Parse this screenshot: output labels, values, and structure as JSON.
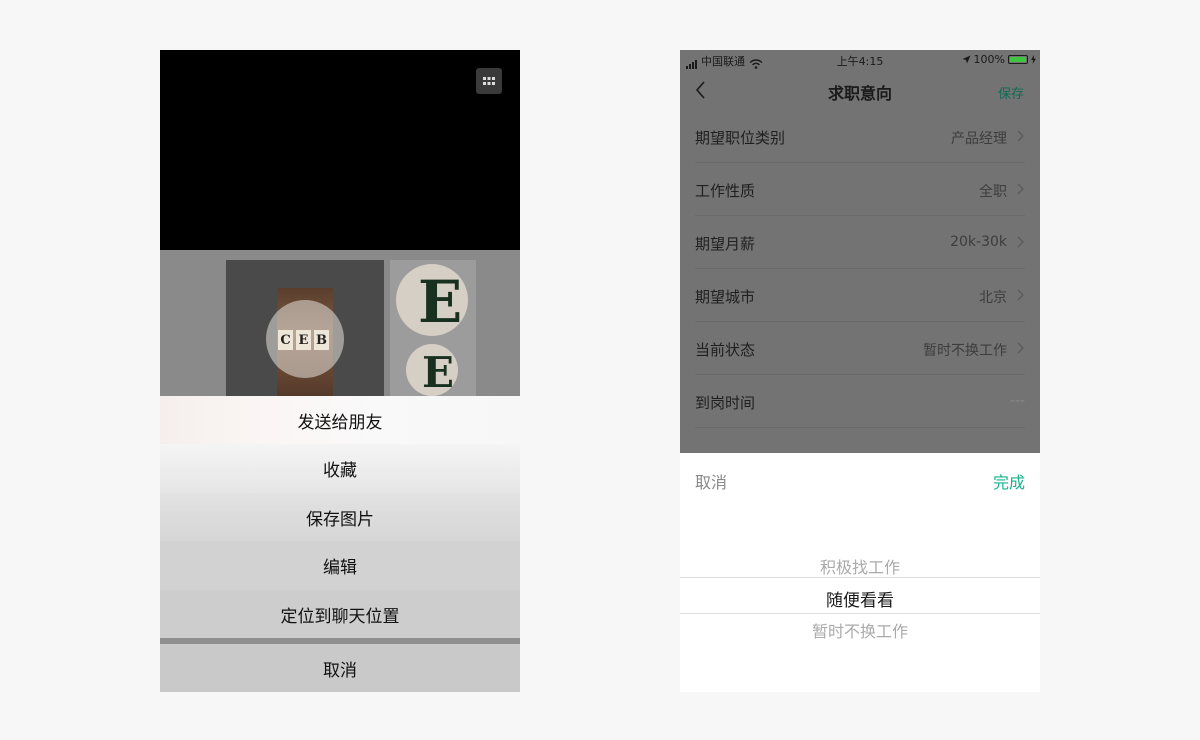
{
  "left_screen": {
    "photo_tiles": [
      "C",
      "E",
      "B"
    ],
    "side_letter": "E",
    "action_sheet": {
      "items": [
        "发送给朋友",
        "收藏",
        "保存图片",
        "编辑",
        "定位到聊天位置"
      ],
      "cancel": "取消"
    }
  },
  "right_screen": {
    "status_bar": {
      "carrier": "中国联通",
      "time": "上午4:15",
      "battery": "100%"
    },
    "nav": {
      "title": "求职意向",
      "save": "保存"
    },
    "rows": [
      {
        "label": "期望职位类别",
        "value": "产品经理"
      },
      {
        "label": "工作性质",
        "value": "全职"
      },
      {
        "label": "期望月薪",
        "value": "20k-30k"
      },
      {
        "label": "期望城市",
        "value": "北京"
      },
      {
        "label": "当前状态",
        "value": "暂时不换工作"
      },
      {
        "label": "到岗时间",
        "value": "---"
      }
    ],
    "picker": {
      "cancel": "取消",
      "done": "完成",
      "options": [
        "积极找工作",
        "随便看看",
        "暂时不换工作"
      ],
      "selected_index": 1
    }
  },
  "colors": {
    "accent_green": "#18b28c",
    "nav_save_green": "#0e6b55",
    "overlay_gray": "#737373"
  }
}
